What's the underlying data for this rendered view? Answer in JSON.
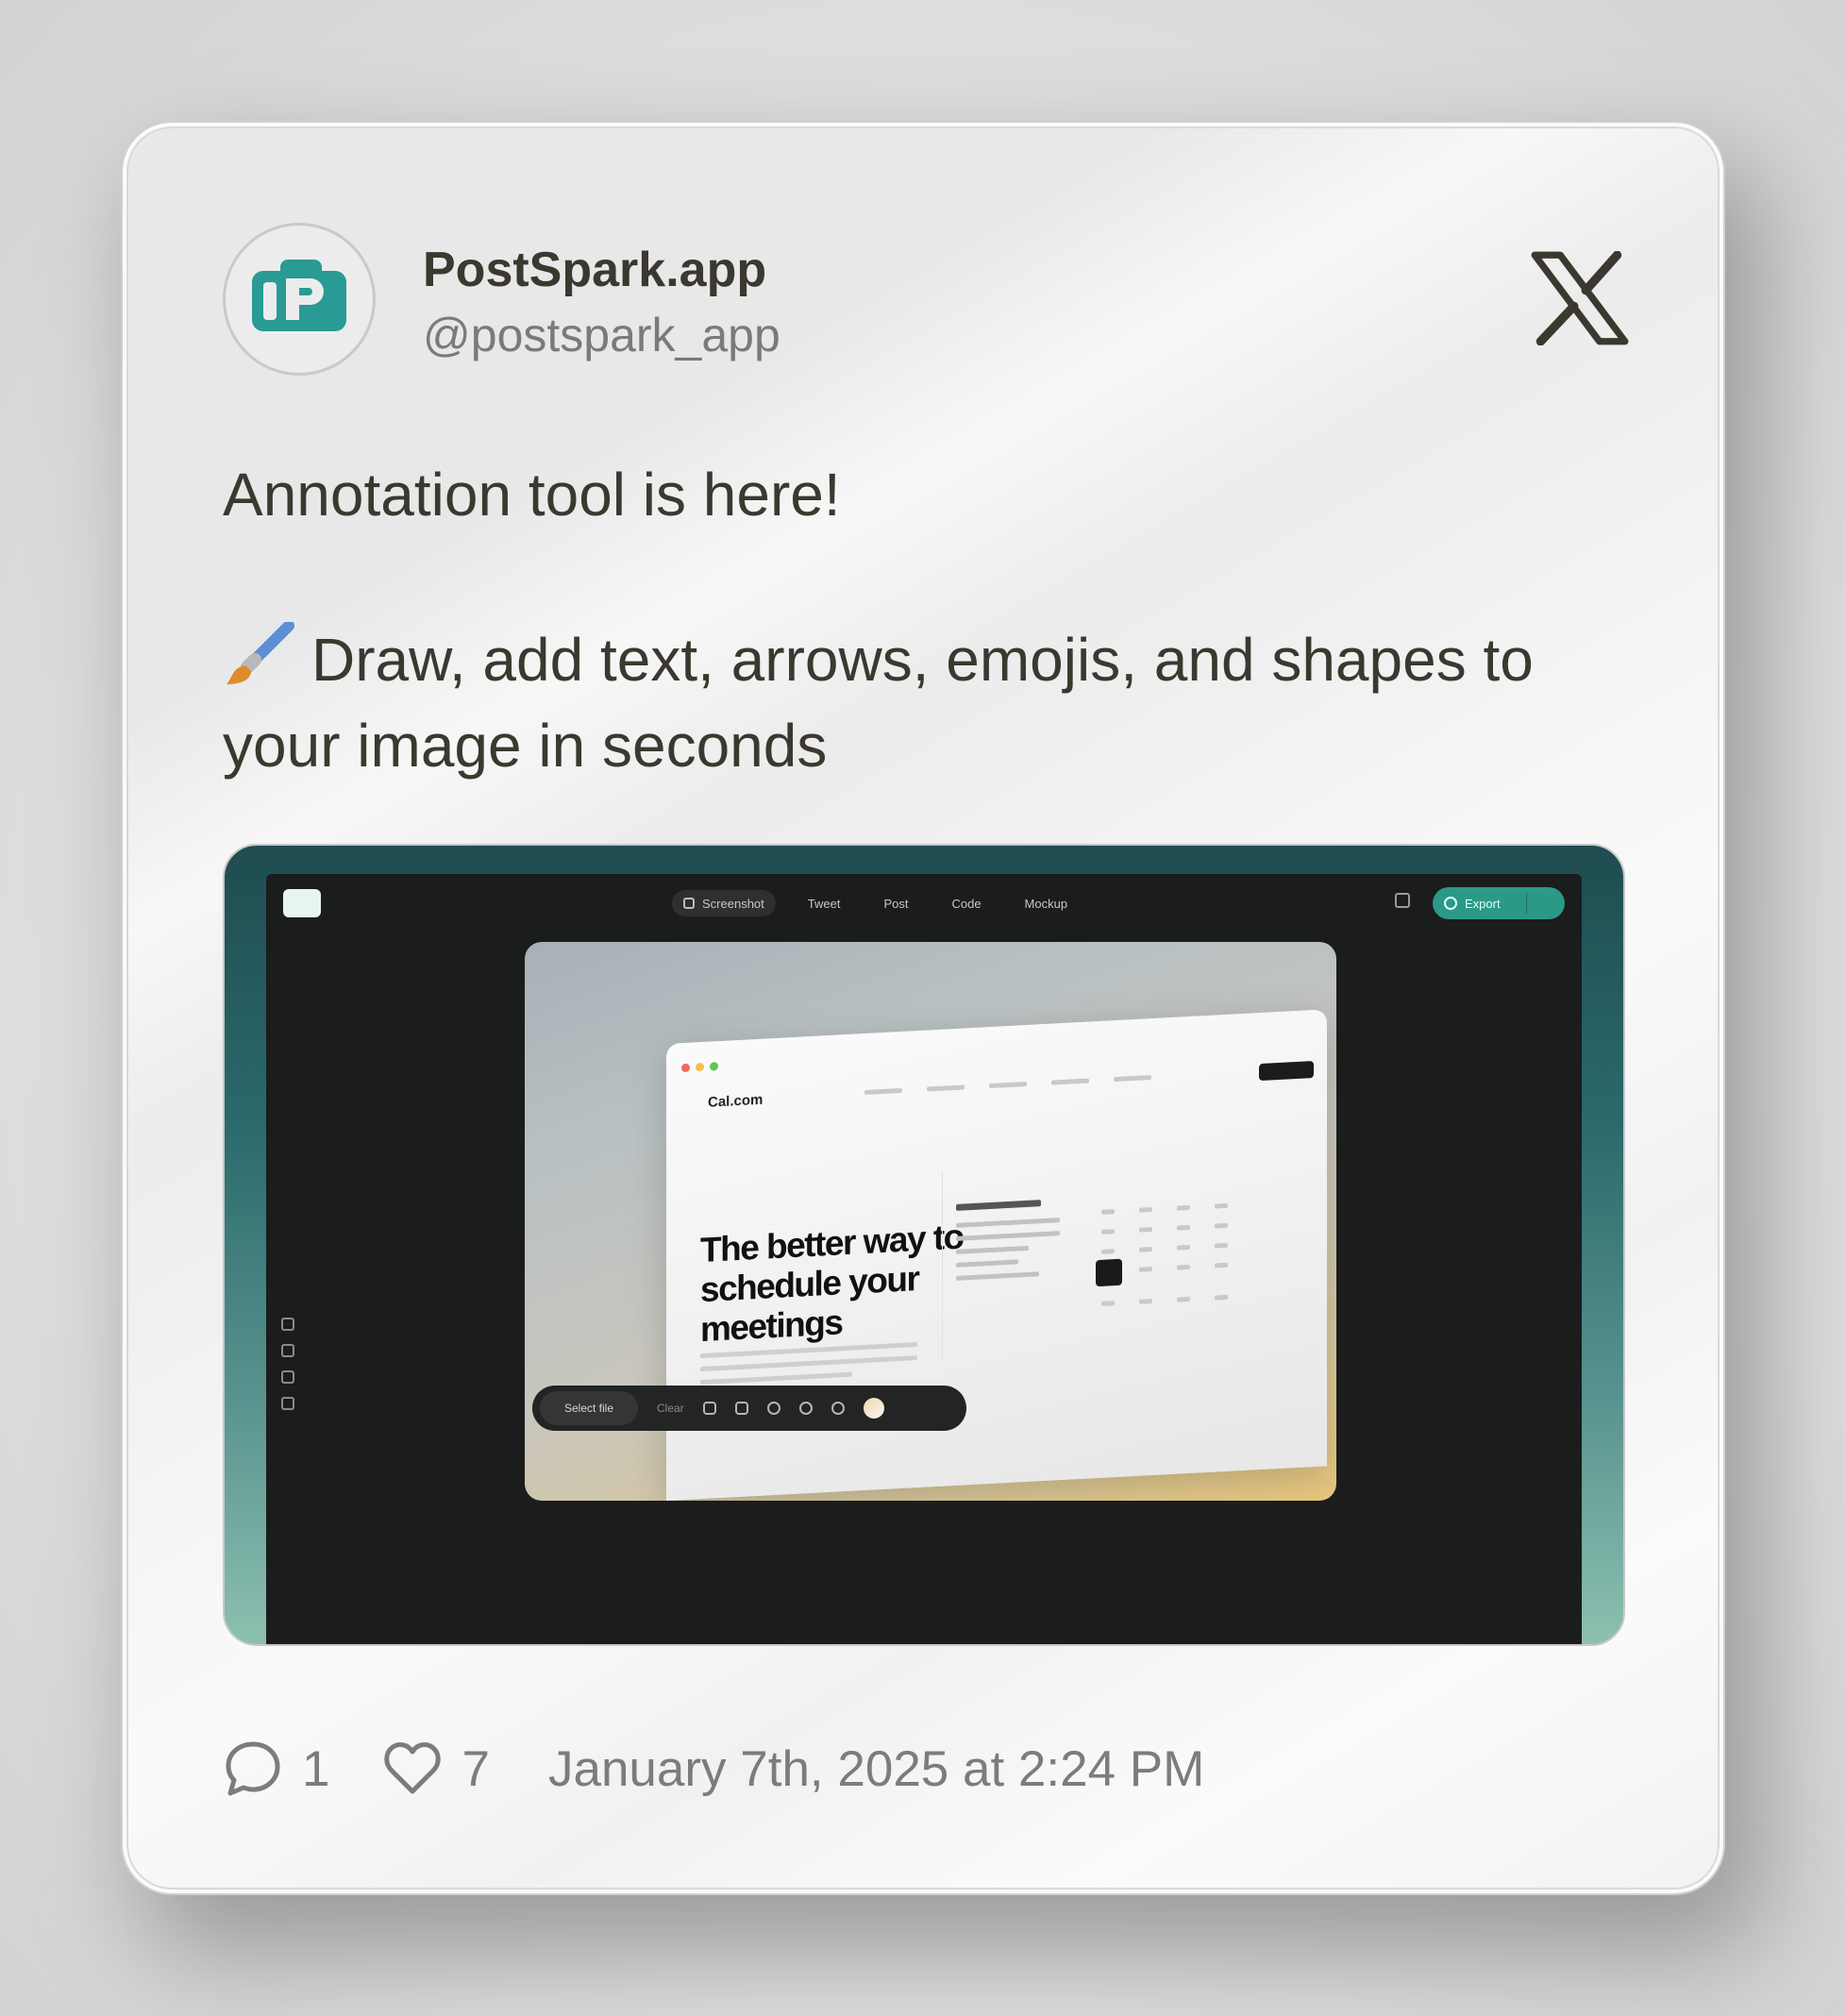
{
  "post": {
    "author_name": "PostSpark.app",
    "author_handle": "@postspark_app",
    "platform_icon": "x-logo-icon",
    "text_line1": "Annotation tool is here!",
    "text_line2": "Draw, add text, arrows, emojis, and shapes to your image in seconds",
    "emoji_icon": "paintbrush-icon",
    "comments": "1",
    "likes": "7",
    "timestamp": "January 7th, 2025 at 2:24 PM"
  },
  "embedded_app": {
    "tabs": [
      "Screenshot",
      "Tweet",
      "Post",
      "Code",
      "Mockup"
    ],
    "export_label": "Export",
    "select_file_label": "Select file",
    "clear_label": "Clear",
    "site_logo": "Cal.com",
    "hero_title": "The better way to schedule your meetings"
  },
  "colors": {
    "brand_teal": "#2a9a86",
    "text_dark": "#3b382f",
    "text_muted": "#7c7c7c"
  }
}
